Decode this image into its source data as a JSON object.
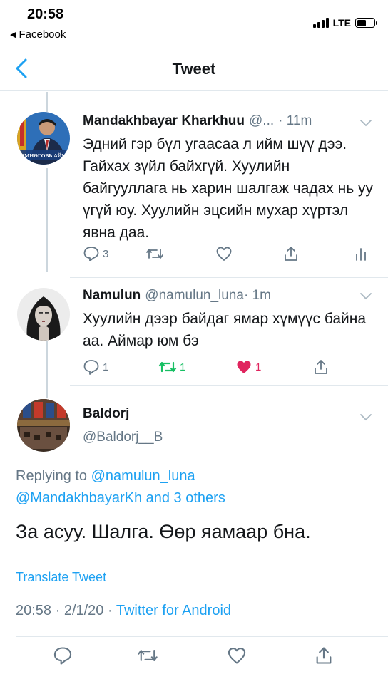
{
  "status_bar": {
    "time": "20:58",
    "back_app": "Facebook",
    "network": "LTE"
  },
  "nav": {
    "title": "Tweet",
    "back_icon": "chevron-left-icon"
  },
  "colors": {
    "accent": "#1da1f2",
    "secondary_text": "#657786",
    "retweet_green": "#17bf63",
    "like_red": "#e0245e"
  },
  "tweets": [
    {
      "name": "Mandakhbayar Kharkhuu",
      "handle": "@...",
      "time": "· 11m",
      "text": "Эдний гэр бүл угаасаа л ийм шүү дээ. Гайхах зүйл байхгүй. Хуулийн байгууллага нь харин шалгаж чадах нь уу үгүй юу. Хуулийн эцсийн мухар хүртэл явна даа.",
      "avatar_banner_text": "ӨМНӨГОВЬ АЙМ",
      "reply_count": "3",
      "retweet_count": "",
      "like_count": ""
    },
    {
      "name": "Namulun",
      "handle": "@namulun_luna",
      "time": "· 1m",
      "text": "Хуулийн дээр байдаг ямар хүмүүс байна аа. Аймар юм бэ",
      "reply_count": "1",
      "retweet_count": "1",
      "like_count": "1",
      "liked": true,
      "retweeted": true
    }
  ],
  "main_tweet": {
    "name": "Baldorj",
    "handle": "@Baldorj__B",
    "replying_prefix": "Replying to ",
    "replying_to_1": "@namulun_luna",
    "replying_to_2": "@MandakhbayarKh and 3 others",
    "text": "За асуу. Шалга. Өөр яамаар бна.",
    "translate": "Translate Tweet",
    "time": "20:58 · 2/1/20 · ",
    "source": "Twitter for Android"
  }
}
